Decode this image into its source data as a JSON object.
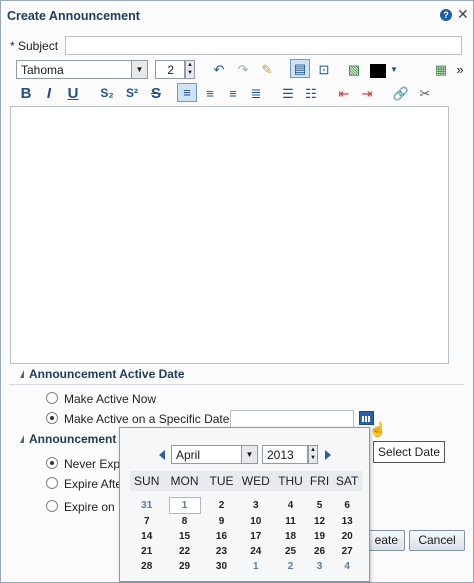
{
  "dialog": {
    "title": "Create Announcement",
    "help": "?",
    "close": "✕"
  },
  "subject": {
    "label": "* Subject",
    "value": ""
  },
  "toolbar": {
    "font": "Tahoma",
    "size": "2",
    "row2": [
      "B",
      "I",
      "U"
    ]
  },
  "active_date": {
    "header": "Announcement Active Date",
    "options": [
      "Make Active Now",
      "Make Active on a Specific Date"
    ],
    "selected_index": 1,
    "date_value": "",
    "tooltip": "Select Date"
  },
  "expiration": {
    "header": "Announcement",
    "options": [
      "Never Exp",
      "Expire Afte",
      "Expire on"
    ],
    "selected_index": 0
  },
  "buttons": {
    "create": "eate",
    "cancel": "Cancel"
  },
  "calendar": {
    "month": "April",
    "year": "2013",
    "weekdays": [
      "SUN",
      "MON",
      "TUE",
      "WED",
      "THU",
      "FRI",
      "SAT"
    ],
    "weeks": [
      [
        "31",
        "1",
        "2",
        "3",
        "4",
        "5",
        "6"
      ],
      [
        "7",
        "8",
        "9",
        "10",
        "11",
        "12",
        "13"
      ],
      [
        "14",
        "15",
        "16",
        "17",
        "18",
        "19",
        "20"
      ],
      [
        "21",
        "22",
        "23",
        "24",
        "25",
        "26",
        "27"
      ],
      [
        "28",
        "29",
        "30",
        "1",
        "2",
        "3",
        "4"
      ]
    ]
  }
}
